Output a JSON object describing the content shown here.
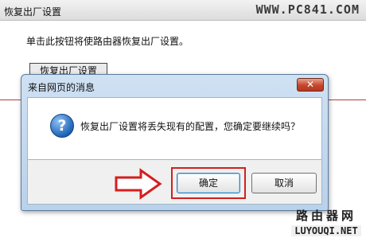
{
  "page": {
    "title": "恢复出厂设置",
    "watermark": "WWW.PC841.COM",
    "description": "单击此按钮将使路由器恢复出厂设置。",
    "reset_button": "恢复出厂设置"
  },
  "dialog": {
    "title": "来自网页的消息",
    "close_label": "✕",
    "icon_glyph": "?",
    "message": "恢复出厂设置将丢失现有的配置，您确定要继续吗？",
    "ok_label": "确定",
    "cancel_label": "取消"
  },
  "bottom_watermark": {
    "cn": "路由器网",
    "en": "LUYOUQI.NET"
  },
  "icons": [
    "question-icon",
    "close-icon",
    "arrow-right-icon"
  ],
  "colors": {
    "highlight": "#d41e1e",
    "dialog_frame": "#b9d1ea",
    "close_button": "#c6452c"
  }
}
